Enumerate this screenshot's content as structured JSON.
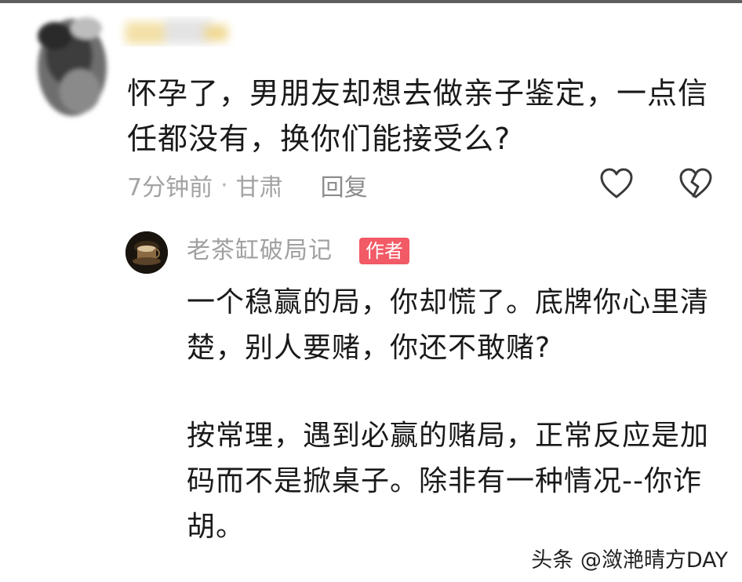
{
  "comment": {
    "text": "怀孕了，男朋友却想去做亲子鉴定，一点信任都没有，换你们能接受么?",
    "time": "7分钟前",
    "separator": "·",
    "location": "甘肃",
    "reply_label": "回复"
  },
  "reply": {
    "author_name": "老茶缸破局记",
    "author_badge": "作者",
    "paragraph1": "一个稳赢的局，你却慌了。底牌你心里清楚，别人要赌，你还不敢赌?",
    "paragraph2": "按常理，遇到必赢的赌局，正常反应是加码而不是掀桌子。除非有一种情况--你诈胡。"
  },
  "watermark": "头条 @潋滟晴方DAY",
  "icons": {
    "like": "heart-outline-icon",
    "dislike": "broken-heart-icon",
    "badge_color": "#f25a66"
  }
}
